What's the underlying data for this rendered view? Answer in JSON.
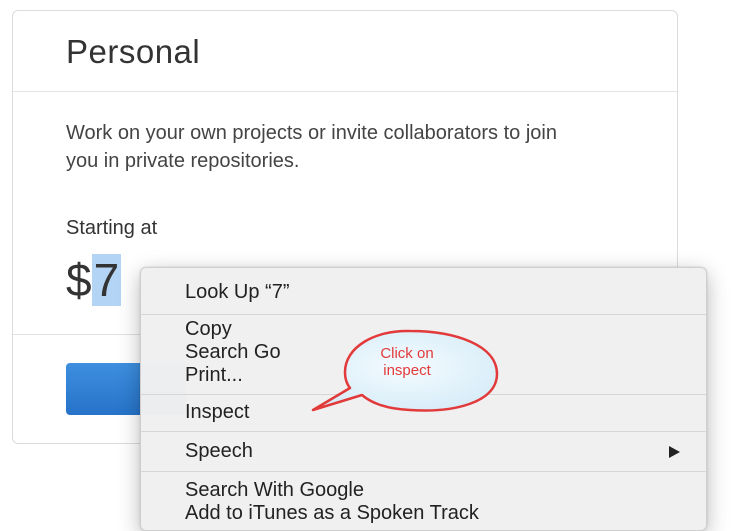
{
  "plan": {
    "title": "Personal",
    "description": "Work on your own projects or invite collaborators to join you in private repositories.",
    "starting_label": "Starting at",
    "currency_symbol": "$",
    "price_number": "7"
  },
  "context_menu": {
    "look_up": "Look Up “7”",
    "copy": "Copy",
    "search_google_truncated": "Search Go",
    "print": "Print...",
    "inspect": "Inspect",
    "speech": "Speech",
    "search_with_google": "Search With Google",
    "add_to_itunes": "Add to iTunes as a Spoken Track"
  },
  "callout": {
    "line1": "Click on",
    "line2": "inspect"
  },
  "colors": {
    "selection": "#b3d4f5",
    "button_blue": "#2673c9",
    "callout_red": "#e23a3a"
  }
}
